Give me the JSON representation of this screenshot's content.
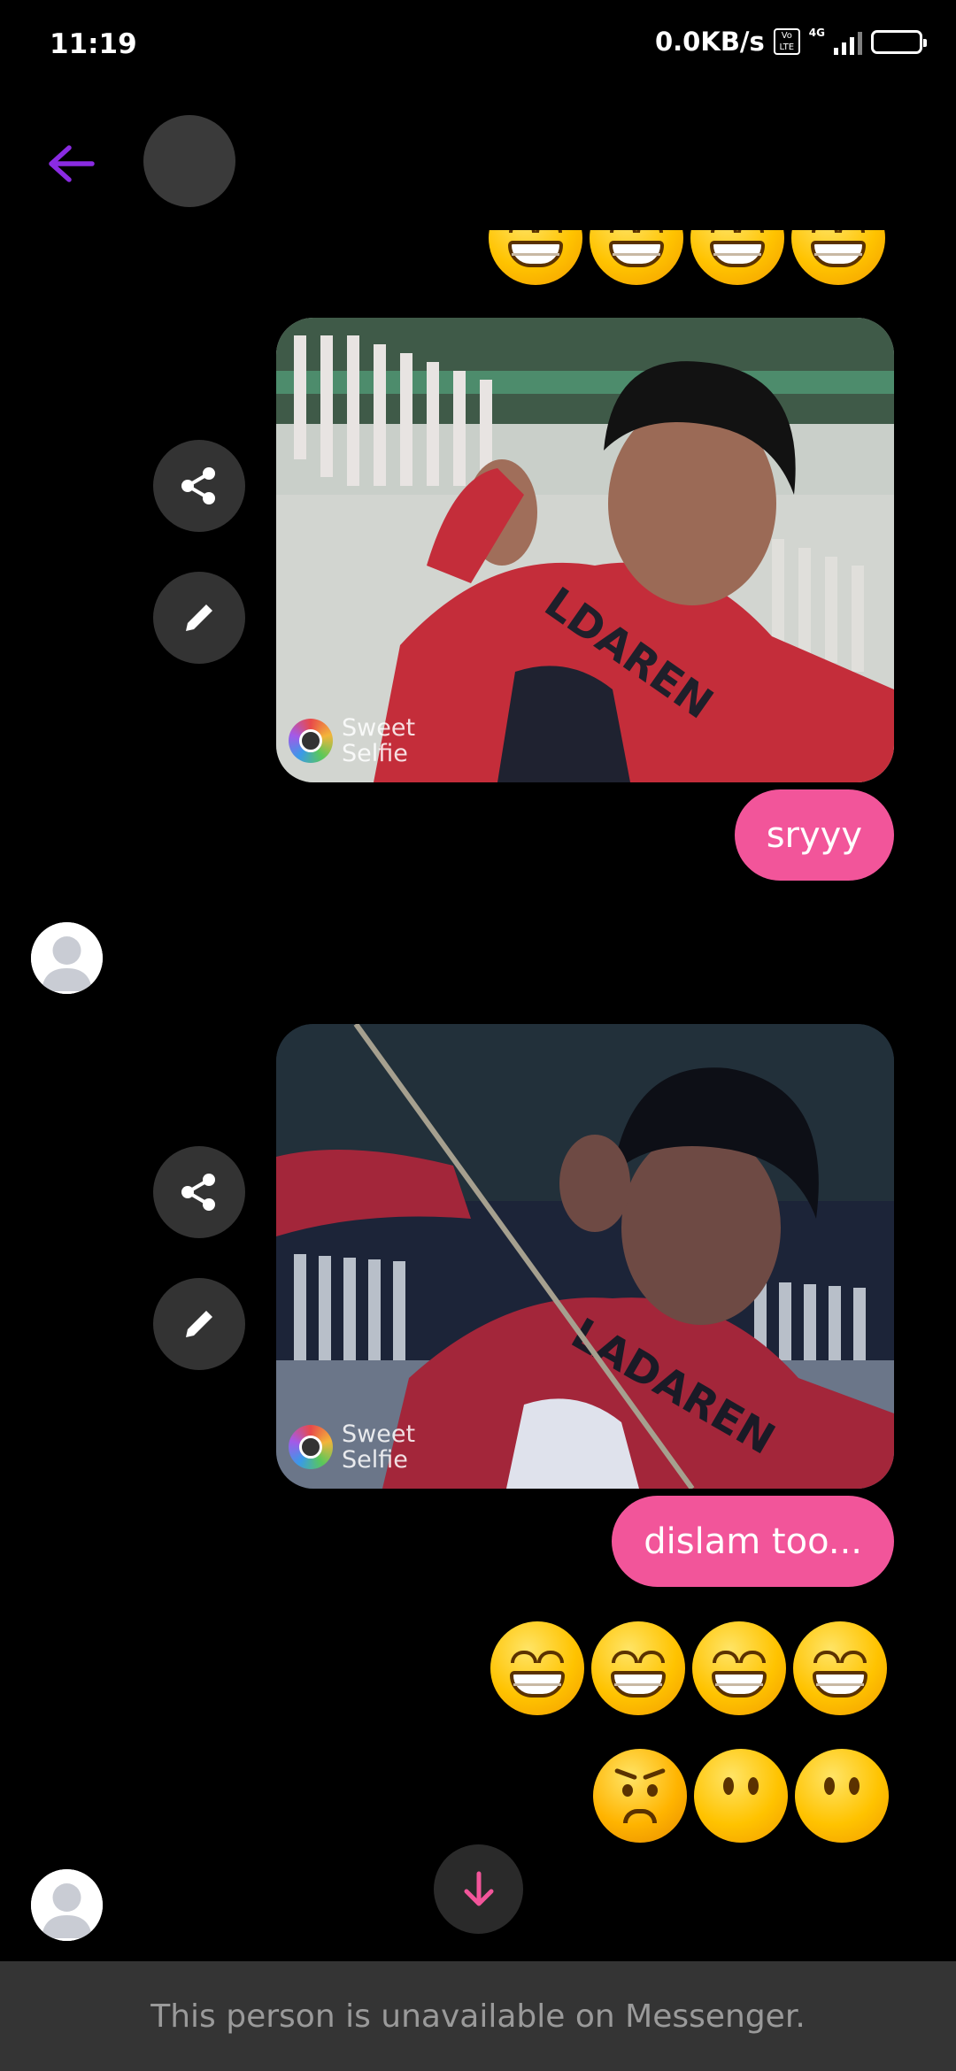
{
  "status_bar": {
    "time": "11:19",
    "net_speed": "0.0KB/s",
    "volte": "Vo LTE",
    "network": "4G"
  },
  "header": {
    "back_icon": "arrow-left-icon",
    "accent_color": "#8a2be2"
  },
  "messages": [
    {
      "type": "emoji_row",
      "emojis": [
        "grinning-face",
        "grinning-face",
        "grinning-face",
        "grinning-face"
      ],
      "cropped": true
    },
    {
      "type": "photo",
      "watermark": [
        "Sweet",
        "Selfie"
      ]
    },
    {
      "type": "text",
      "text": "sryyy"
    },
    {
      "type": "photo",
      "watermark": [
        "Sweet",
        "Selfie"
      ]
    },
    {
      "type": "text",
      "text": "dislam too..."
    },
    {
      "type": "emoji_row",
      "emojis": [
        "grinning-face",
        "grinning-face",
        "grinning-face",
        "grinning-face"
      ]
    },
    {
      "type": "emoji_row",
      "emojis": [
        "angry-face",
        "no-mouth-face",
        "no-mouth-face"
      ]
    }
  ],
  "bubble_color": "#f2559a",
  "footer": {
    "text": "This person is unavailable on Messenger."
  }
}
